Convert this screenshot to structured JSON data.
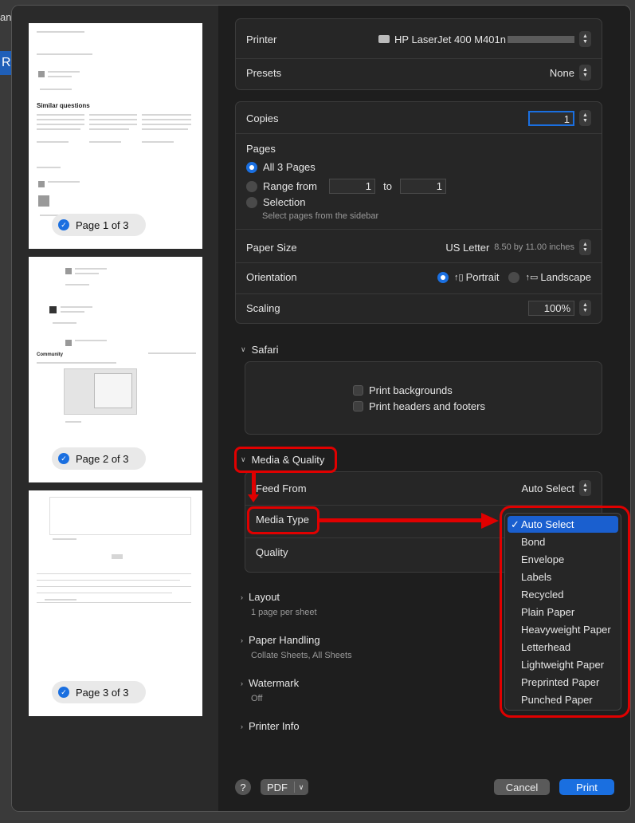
{
  "background": {
    "frag1": "an",
    "frag2": "R"
  },
  "pages": [
    {
      "label": "Page 1 of 3"
    },
    {
      "label": "Page 2 of 3"
    },
    {
      "label": "Page 3 of 3"
    }
  ],
  "thumb1": {
    "heading": "Similar questions"
  },
  "thumb2": {
    "heading": "Community"
  },
  "printer": {
    "label": "Printer",
    "value": "HP LaserJet 400 M401n"
  },
  "presets": {
    "label": "Presets",
    "value": "None"
  },
  "copies": {
    "label": "Copies",
    "value": "1"
  },
  "pages_section": {
    "label": "Pages",
    "all": "All 3 Pages",
    "range": "Range from",
    "range_from": "1",
    "range_to_label": "to",
    "range_to": "1",
    "selection": "Selection",
    "selection_hint": "Select pages from the sidebar"
  },
  "paper_size": {
    "label": "Paper Size",
    "value": "US Letter",
    "detail": "8.50 by 11.00 inches"
  },
  "orientation": {
    "label": "Orientation",
    "portrait": "Portrait",
    "landscape": "Landscape",
    "selected": "Portrait"
  },
  "scaling": {
    "label": "Scaling",
    "value": "100%"
  },
  "safari": {
    "label": "Safari",
    "print_backgrounds": "Print backgrounds",
    "print_headers": "Print headers and footers"
  },
  "media_quality": {
    "label": "Media & Quality",
    "feed_from_label": "Feed From",
    "feed_from_value": "Auto Select",
    "media_type_label": "Media Type",
    "quality_label": "Quality"
  },
  "media_menu": {
    "selected": "Auto Select",
    "items": [
      "Auto Select",
      "Bond",
      "Envelope",
      "Labels",
      "Recycled",
      "Plain Paper",
      "Heavyweight Paper",
      "Letterhead",
      "Lightweight Paper",
      "Preprinted Paper",
      "Punched Paper"
    ]
  },
  "layout": {
    "label": "Layout",
    "detail": "1 page per sheet"
  },
  "paper_handling": {
    "label": "Paper Handling",
    "detail": "Collate Sheets, All Sheets"
  },
  "watermark": {
    "label": "Watermark",
    "detail": "Off"
  },
  "printer_info": {
    "label": "Printer Info"
  },
  "footer": {
    "help": "?",
    "pdf": "PDF",
    "cancel": "Cancel",
    "print": "Print"
  },
  "colors": {
    "accent": "#1a6fe0",
    "annotation": "#e00000"
  }
}
